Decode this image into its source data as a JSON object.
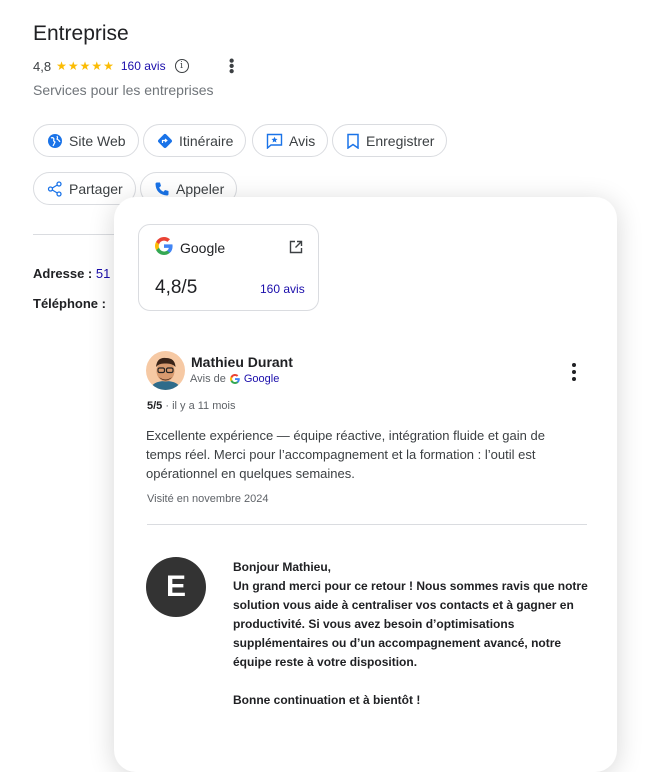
{
  "business": {
    "name": "Entreprise",
    "rating": "4,8",
    "stars": "★★★★★",
    "review_count": "160 avis",
    "category": "Services pour les entreprises"
  },
  "actions": [
    {
      "label": "Site Web",
      "icon": "globe-icon"
    },
    {
      "label": "Itinéraire",
      "icon": "directions-icon"
    },
    {
      "label": "Avis",
      "icon": "review-icon"
    },
    {
      "label": "Enregistrer",
      "icon": "bookmark-icon"
    },
    {
      "label": "Partager",
      "icon": "share-icon"
    },
    {
      "label": "Appeler",
      "icon": "phone-icon"
    }
  ],
  "details": {
    "address_label": "Adresse :",
    "address_value": "51",
    "phone_label": "Téléphone :"
  },
  "card": {
    "source_name": "Google",
    "score": "4,8/5",
    "source_count": "160 avis",
    "review": {
      "author": "Mathieu Durant",
      "via_label": "Avis de",
      "via_source": "Google",
      "rating": "5/5",
      "time": " · il y a 11 mois",
      "text": "Excellente expérience — équipe réactive, intégration fluide et gain de temps réel. Merci pour l’accompagnement et la formation : l’outil est opérationnel en quelques semaines.",
      "visited": "Visité en novembre 2024"
    },
    "reply": {
      "avatar_letter": "E",
      "greeting": "Bonjour Mathieu,",
      "body": "Un grand merci pour ce retour ! Nous sommes ravis que notre solution vous aide à centraliser vos contacts et à gagner en productivité. Si vous avez besoin d’optimisations supplémentaires ou d’un accompagnement avancé, notre équipe reste à votre disposition.",
      "closing": "Bonne continuation et à bientôt !"
    }
  },
  "colors": {
    "star": "#fbbc04",
    "link": "#1a0dab",
    "icon_blue": "#1a73e8",
    "owner_avatar": "#333333"
  }
}
